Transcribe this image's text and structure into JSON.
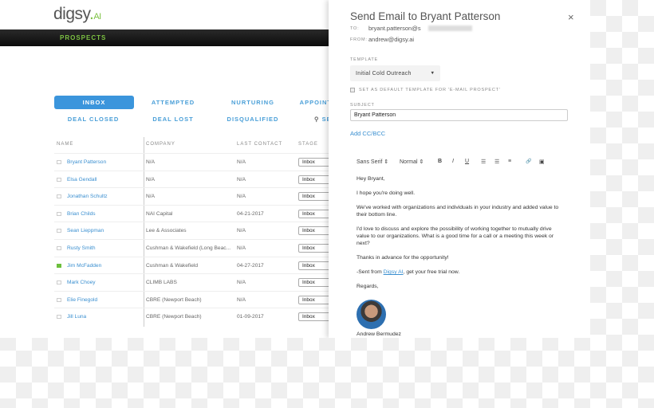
{
  "app": {
    "logo_text": "digsy",
    "logo_dot": ".",
    "logo_suffix": "AI",
    "nav": "PROSPECTS"
  },
  "tabs": [
    {
      "label": "INBOX",
      "active": true
    },
    {
      "label": "ATTEMPTED"
    },
    {
      "label": "NURTURING"
    },
    {
      "label": "APPOINT"
    },
    {
      "label": "DEAL CLOSED"
    },
    {
      "label": "DEAL LOST"
    },
    {
      "label": "DISQUALIFIED"
    },
    {
      "label": "SE",
      "icon": "search-icon"
    }
  ],
  "table": {
    "headers": [
      "NAME",
      "COMPANY",
      "LAST CONTACT",
      "STAGE"
    ],
    "rows": [
      {
        "name": "Bryant Patterson",
        "company": "N/A",
        "last_contact": "N/A",
        "stage": "Inbox",
        "flag": false
      },
      {
        "name": "Elsa Gendall",
        "company": "N/A",
        "last_contact": "N/A",
        "stage": "Inbox",
        "flag": false
      },
      {
        "name": "Jonathan Schultz",
        "company": "N/A",
        "last_contact": "N/A",
        "stage": "Inbox",
        "flag": false
      },
      {
        "name": "Brian Childs",
        "company": "NAI Capital",
        "last_contact": "04-21-2017",
        "stage": "Inbox",
        "flag": false
      },
      {
        "name": "Sean Lieppman",
        "company": "Lee & Associates",
        "last_contact": "N/A",
        "stage": "Inbox",
        "flag": false
      },
      {
        "name": "Rusty Smith",
        "company": "Cushman & Wakefield (Long Beac...",
        "last_contact": "N/A",
        "stage": "Inbox",
        "flag": false
      },
      {
        "name": "Jim McFadden",
        "company": "Cushman & Wakefield",
        "last_contact": "04-27-2017",
        "stage": "Inbox",
        "flag": true
      },
      {
        "name": "Mark Choey",
        "company": "CLIMB LABS",
        "last_contact": "N/A",
        "stage": "Inbox",
        "flag": false
      },
      {
        "name": "Elie Finegold",
        "company": "CBRE (Newport Beach)",
        "last_contact": "N/A",
        "stage": "Inbox",
        "flag": false
      },
      {
        "name": "Jill Luna",
        "company": "CBRE (Newport Beach)",
        "last_contact": "01-09-2017",
        "stage": "Inbox",
        "flag": false
      }
    ]
  },
  "modal": {
    "title": "Send Email to Bryant Patterson",
    "close": "×",
    "to_label": "TO:",
    "to": "bryant.patterson@s",
    "from_label": "FROM:",
    "from": "andrew@digsy.ai",
    "template_label": "TEMPLATE",
    "template": "Initial Cold Outreach",
    "default_label": "SET AS DEFAULT TEMPLATE FOR 'E-MAIL PROSPECT'",
    "subject_label": "SUBJECT",
    "subject": "Bryant Patterson",
    "add_cc": "Add CC/BCC",
    "toolbar": {
      "font": "Sans Serif ⇕",
      "size": "Normal ⇕",
      "bold": "B",
      "italic": "I",
      "underline": "U",
      "ol": "☰",
      "ul": "☰",
      "align": "≡",
      "link": "🔗",
      "image": "▣"
    },
    "body": {
      "greeting": "Hey Bryant,",
      "p1": "I hope you're doing well.",
      "p2": "We've worked with organizations and individuals in your industry and added value to their bottom line.",
      "p3": "I'd love to discuss and explore the possibility of working together to mutually drive value to our organizations. What is a good time for a call or a meeting this week or next?",
      "p4": "Thanks in advance for the opportunity!",
      "sent_pre": "-Sent from ",
      "sent_link": "Digsy AI",
      "sent_post": ", get your free trial now.",
      "regards": "Regards,",
      "signature": "Andrew Bermudez"
    }
  },
  "colors": {
    "accent": "#3b95dc",
    "brand_green": "#7dc243"
  }
}
